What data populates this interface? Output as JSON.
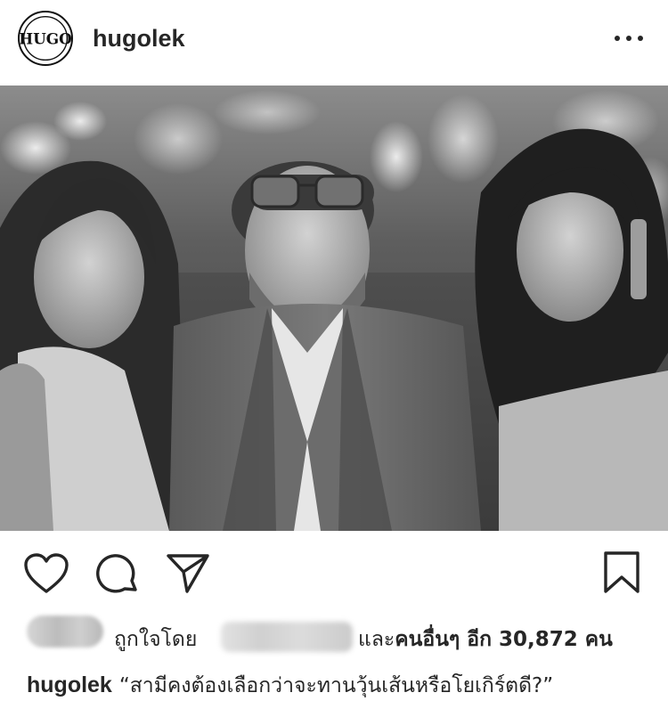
{
  "post": {
    "username": "hugolek",
    "avatar_text": "HUGO",
    "more_icon": "more-horizontal-icon"
  },
  "actions": {
    "like_icon": "heart-icon",
    "comment_icon": "comment-icon",
    "share_icon": "send-icon",
    "save_icon": "bookmark-icon"
  },
  "likes": {
    "prefix": "ถูกใจโดย",
    "middle_before": "และ",
    "others_bold": "คนอื่นๆ อีก 30,872 คน"
  },
  "caption": {
    "username": "hugolek",
    "text": "“สามีคงต้องเลือกว่าจะทานวุ้นเส้นหรือโยเกิร์ตดี?”"
  }
}
